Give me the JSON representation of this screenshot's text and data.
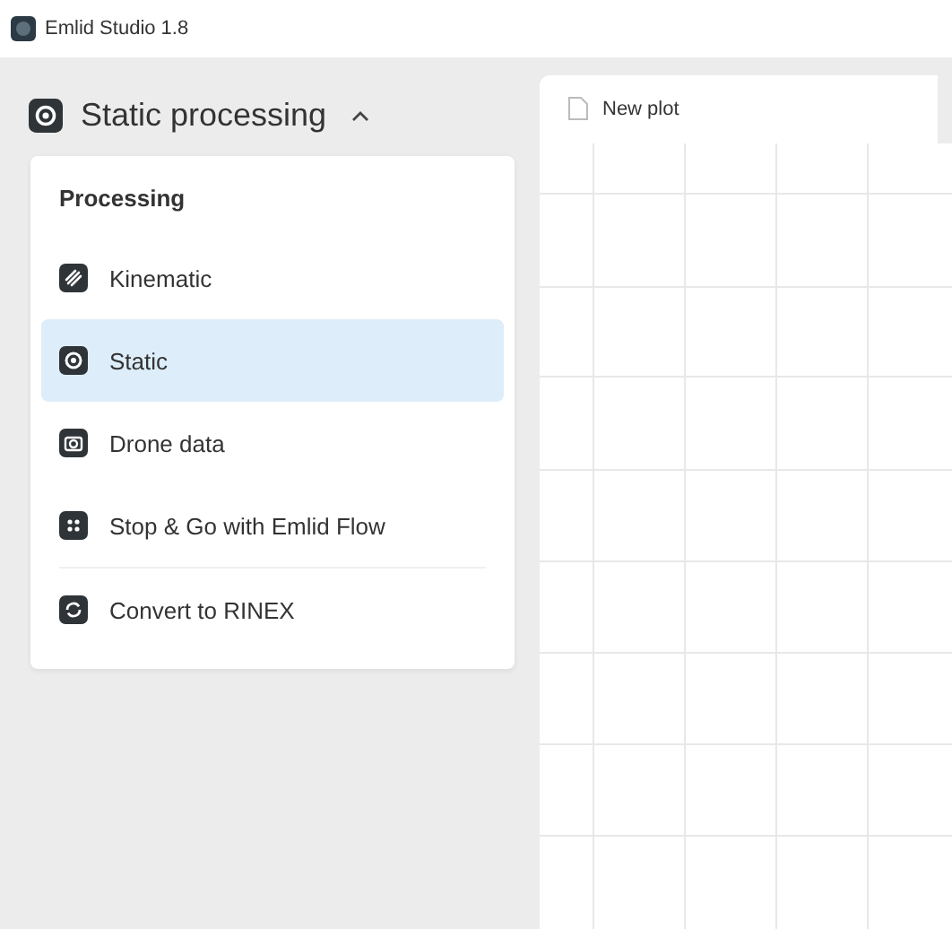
{
  "window": {
    "title": "Emlid Studio 1.8"
  },
  "mode_selector": {
    "label": "Static processing",
    "expanded": true
  },
  "menu": {
    "heading": "Processing",
    "items": [
      {
        "label": "Kinematic",
        "kind": "kinematic",
        "selected": false
      },
      {
        "label": "Static",
        "kind": "static",
        "selected": true
      },
      {
        "label": "Drone data",
        "kind": "drone",
        "selected": false
      },
      {
        "label": "Stop & Go with Emlid Flow",
        "kind": "stopgo",
        "selected": false
      },
      {
        "label": "Convert to RINEX",
        "kind": "convert",
        "selected": false,
        "divider_before": true
      }
    ]
  },
  "plot_tabs": [
    {
      "label": "New plot"
    }
  ]
}
